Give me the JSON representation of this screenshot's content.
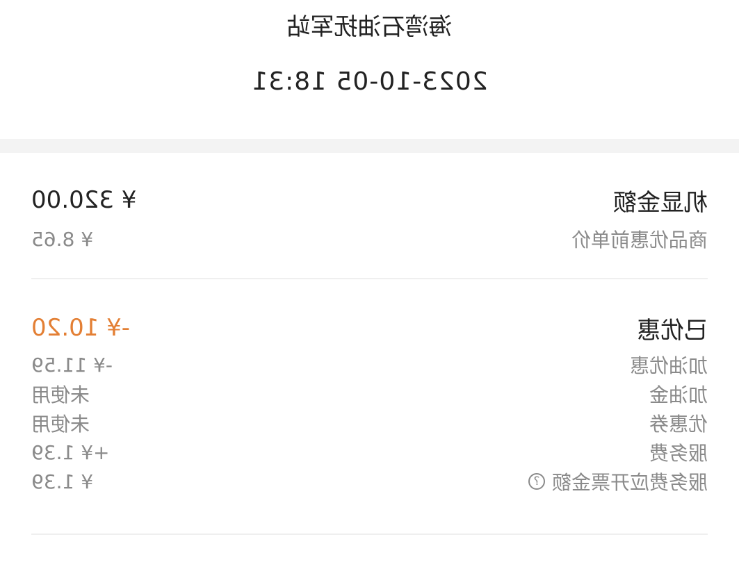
{
  "header": {
    "station": "海湾石油抚军站",
    "datetime": "2023-10-05 18:31"
  },
  "amount": {
    "label": "机显金额",
    "value": "¥ 320.00",
    "unit_price_label": "商品优惠前单价",
    "unit_price_value": "¥ 8.65"
  },
  "discount": {
    "label": "已优惠",
    "value": "-¥ 10.20",
    "items": [
      {
        "label": "加油优惠",
        "value": "-¥ 11.59"
      },
      {
        "label": "加油金",
        "value": "未使用"
      },
      {
        "label": "优惠券",
        "value": "未使用"
      },
      {
        "label": "服务费",
        "value": "+¥ 1.39"
      },
      {
        "label": "服务费应开票金额",
        "value": "¥ 1.39"
      }
    ],
    "help_icon": "question-circle-icon"
  },
  "colors": {
    "accent": "#e37f34",
    "secondary_text": "#8a8a8a",
    "divider": "#efefef"
  }
}
